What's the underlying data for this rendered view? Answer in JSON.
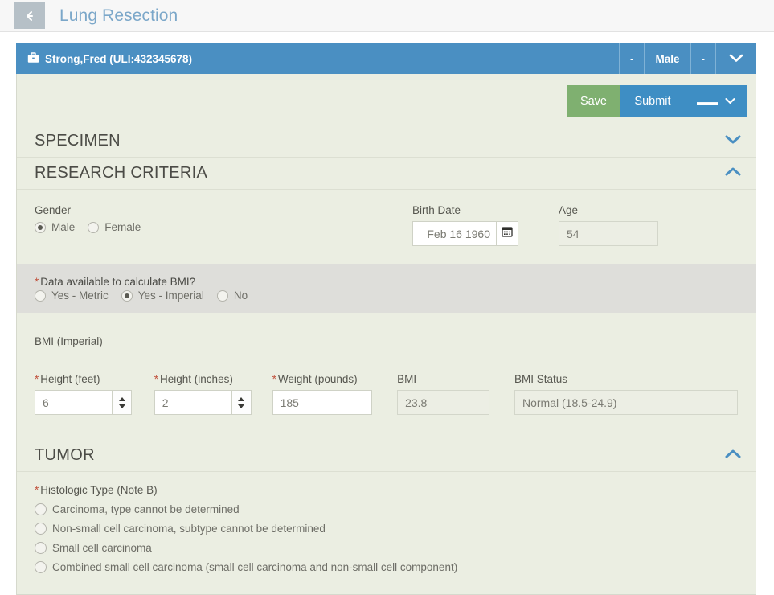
{
  "topbar": {
    "back_icon": "arrow-left-icon",
    "title": "Lung Resection"
  },
  "patient": {
    "icon": "briefcase-icon",
    "name": "Strong,Fred (ULI:432345678)",
    "meta": [
      "-",
      "Male",
      "-"
    ],
    "expand_icon": "chevron-down-icon"
  },
  "toolbar": {
    "save_label": "Save",
    "submit_label": "Submit",
    "more_dots": "▬▬",
    "more_caret": "chevron-down-icon"
  },
  "sections": {
    "specimen": {
      "title": "SPECIMEN",
      "expanded": false,
      "chevron": "chevron-down-icon"
    },
    "research": {
      "title": "RESEARCH CRITERIA",
      "expanded": true,
      "chevron": "chevron-up-icon"
    },
    "tumor": {
      "title": "TUMOR",
      "expanded": true,
      "chevron": "chevron-up-icon"
    }
  },
  "research": {
    "gender": {
      "label": "Gender",
      "options": [
        "Male",
        "Female"
      ],
      "selected": "Male"
    },
    "birth_date": {
      "label": "Birth Date",
      "value": "Feb 16 1960",
      "calendar_icon": "calendar-icon"
    },
    "age": {
      "label": "Age",
      "value": "54"
    },
    "bmi_available": {
      "label": "Data available to calculate BMI?",
      "required": "*",
      "options": [
        "Yes - Metric",
        "Yes - Imperial",
        "No"
      ],
      "selected": "Yes - Imperial"
    },
    "bmi_group_label": "BMI (Imperial)",
    "height_feet": {
      "label": "Height (feet)",
      "required": "*",
      "value": "6"
    },
    "height_inches": {
      "label": "Height (inches)",
      "required": "*",
      "value": "2"
    },
    "weight_pounds": {
      "label": "Weight (pounds)",
      "required": "*",
      "value": "185"
    },
    "bmi": {
      "label": "BMI",
      "value": "23.8"
    },
    "bmi_status": {
      "label": "BMI Status",
      "value": "Normal (18.5-24.9)"
    }
  },
  "tumor": {
    "histologic_type": {
      "label": "Histologic Type (Note B)",
      "required": "*",
      "selected": null,
      "options": [
        "Carcinoma, type cannot be determined",
        "Non-small cell carcinoma, subtype cannot be determined",
        "Small cell carcinoma",
        "Combined small cell carcinoma (small cell carcinoma and non-small cell component)"
      ]
    }
  },
  "colors": {
    "accent_blue": "#4a8fc2",
    "save_green": "#7fb070",
    "panel_bg": "#ebeee2",
    "band_bg": "#dededa",
    "required_red": "#c0513c"
  }
}
